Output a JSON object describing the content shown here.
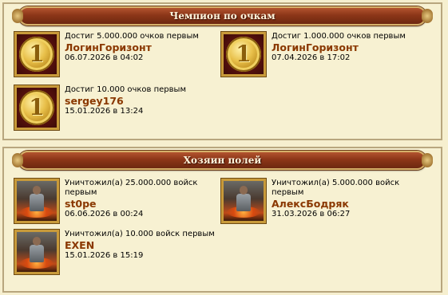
{
  "sections": [
    {
      "title": "Чемпион по очкам",
      "entries": [
        {
          "badge": "1",
          "description": "Достиг 5.000.000 очков первым",
          "name": "ЛогинГоризонт",
          "date": "06.07.2026 в 04:02"
        },
        {
          "badge": "1",
          "description": "Достиг 1.000.000 очков первым",
          "name": "ЛогинГоризонт",
          "date": "07.04.2026 в 17:02"
        },
        {
          "badge": "1",
          "description": "Достиг 10.000 очков первым",
          "name": "sergey176",
          "date": "15.01.2026 в 13:24"
        }
      ]
    },
    {
      "title": "Хозяин полей",
      "entries": [
        {
          "description": "Уничтожил(а) 25.000.000 войск первым",
          "name": "st0pe",
          "date": "06.06.2026 в 00:24"
        },
        {
          "description": "Уничтожил(а) 5.000.000 войск первым",
          "name": "АлексБодряк",
          "date": "31.03.2026 в 06:27"
        },
        {
          "description": "Уничтожил(а) 10.000 войск первым",
          "name": "EXEN",
          "date": "15.01.2026 в 15:19"
        }
      ]
    }
  ],
  "colors": {
    "header_bg": "#8c3618",
    "header_border": "#d6b06a",
    "name": "#8a3800",
    "page_bg": "#f6efcf"
  },
  "icons": {
    "score_badge": "gold-coin-icon",
    "fields_badge": "warrior-portrait-icon"
  }
}
